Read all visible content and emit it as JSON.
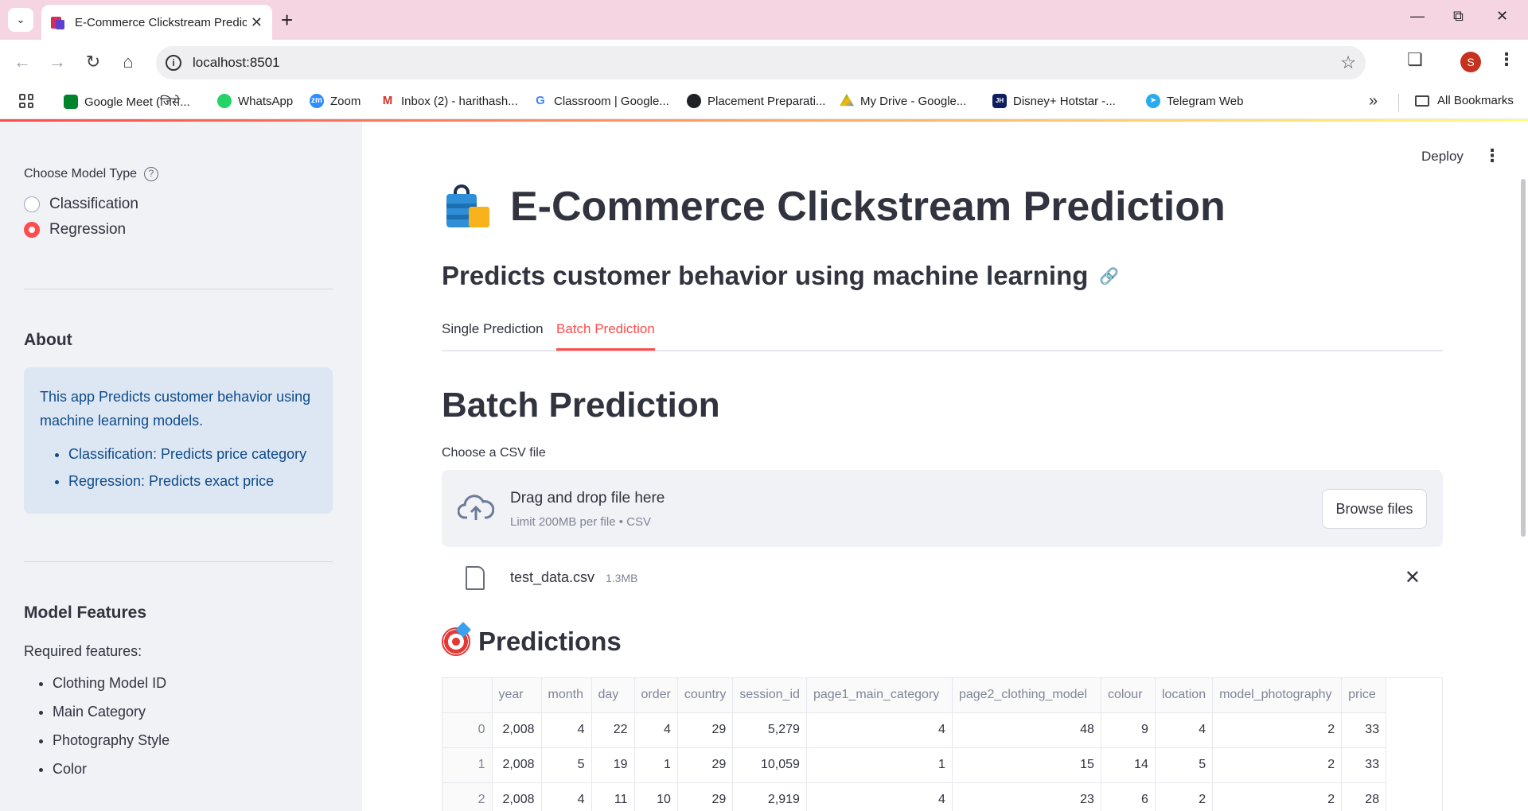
{
  "browser": {
    "tab_title": "E-Commerce Clickstream Predic",
    "url": "localhost:8501",
    "profile_initial": "S",
    "bookmarks": [
      {
        "label": "Google Meet (जिसे...",
        "icon": "google-meet-icon",
        "color": "#00832d"
      },
      {
        "label": "WhatsApp",
        "icon": "whatsapp-icon",
        "color": "#25d366"
      },
      {
        "label": "Zoom",
        "icon": "zoom-icon",
        "color": "#2d8cff"
      },
      {
        "label": "Inbox (2) - harithash...",
        "icon": "gmail-icon",
        "color": "#d93025"
      },
      {
        "label": "Classroom | Google...",
        "icon": "google-icon",
        "color": "#4285f4"
      },
      {
        "label": "Placement Preparati...",
        "icon": "globe-icon",
        "color": "#202124"
      },
      {
        "label": "My Drive - Google...",
        "icon": "google-drive-icon",
        "color": "#fbbc04"
      },
      {
        "label": "Disney+ Hotstar -...",
        "icon": "hotstar-icon",
        "color": "#0f1e5f"
      },
      {
        "label": "Telegram Web",
        "icon": "telegram-icon",
        "color": "#2aabee"
      }
    ],
    "all_bookmarks": "All Bookmarks"
  },
  "sidebar": {
    "model_label": "Choose Model Type",
    "options": [
      "Classification",
      "Regression"
    ],
    "selected": "Regression",
    "about_heading": "About",
    "about_text": "This app Predicts customer behavior using machine learning models.",
    "about_items": [
      "Classification: Predicts price category",
      "Regression: Predicts exact price"
    ],
    "features_heading": "Model Features",
    "features_intro": "Required features:",
    "features": [
      "Clothing Model ID",
      "Main Category",
      "Photography Style",
      "Color"
    ]
  },
  "main": {
    "deploy": "Deploy",
    "title": "E-Commerce Clickstream Prediction",
    "subtitle": "Predicts customer behavior using machine learning",
    "tabs": [
      "Single Prediction",
      "Batch Prediction"
    ],
    "active_tab": "Batch Prediction",
    "section_heading": "Batch Prediction",
    "uploader_label": "Choose a CSV file",
    "drop_text": "Drag and drop file here",
    "drop_limit": "Limit 200MB per file • CSV",
    "browse": "Browse files",
    "file_name": "test_data.csv",
    "file_size": "1.3MB",
    "predictions_heading": "Predictions"
  },
  "table": {
    "columns": [
      "",
      "year",
      "month",
      "day",
      "order",
      "country",
      "session_id",
      "page1_main_category",
      "page2_clothing_model",
      "colour",
      "location",
      "model_photography",
      "price"
    ],
    "rows": [
      [
        "0",
        "2,008",
        "4",
        "22",
        "4",
        "29",
        "5,279",
        "4",
        "48",
        "9",
        "4",
        "2",
        "33"
      ],
      [
        "1",
        "2,008",
        "5",
        "19",
        "1",
        "29",
        "10,059",
        "1",
        "15",
        "14",
        "5",
        "2",
        "33"
      ],
      [
        "2",
        "2,008",
        "4",
        "11",
        "10",
        "29",
        "2,919",
        "4",
        "23",
        "6",
        "2",
        "2",
        "28"
      ]
    ]
  },
  "colors": {
    "accent": "#ff4b4b",
    "sidebar_bg": "#f0f2f6",
    "info_bg": "#dde7f3",
    "info_text": "#0e4b8a",
    "tabbar_bg": "#f5d5e1"
  }
}
